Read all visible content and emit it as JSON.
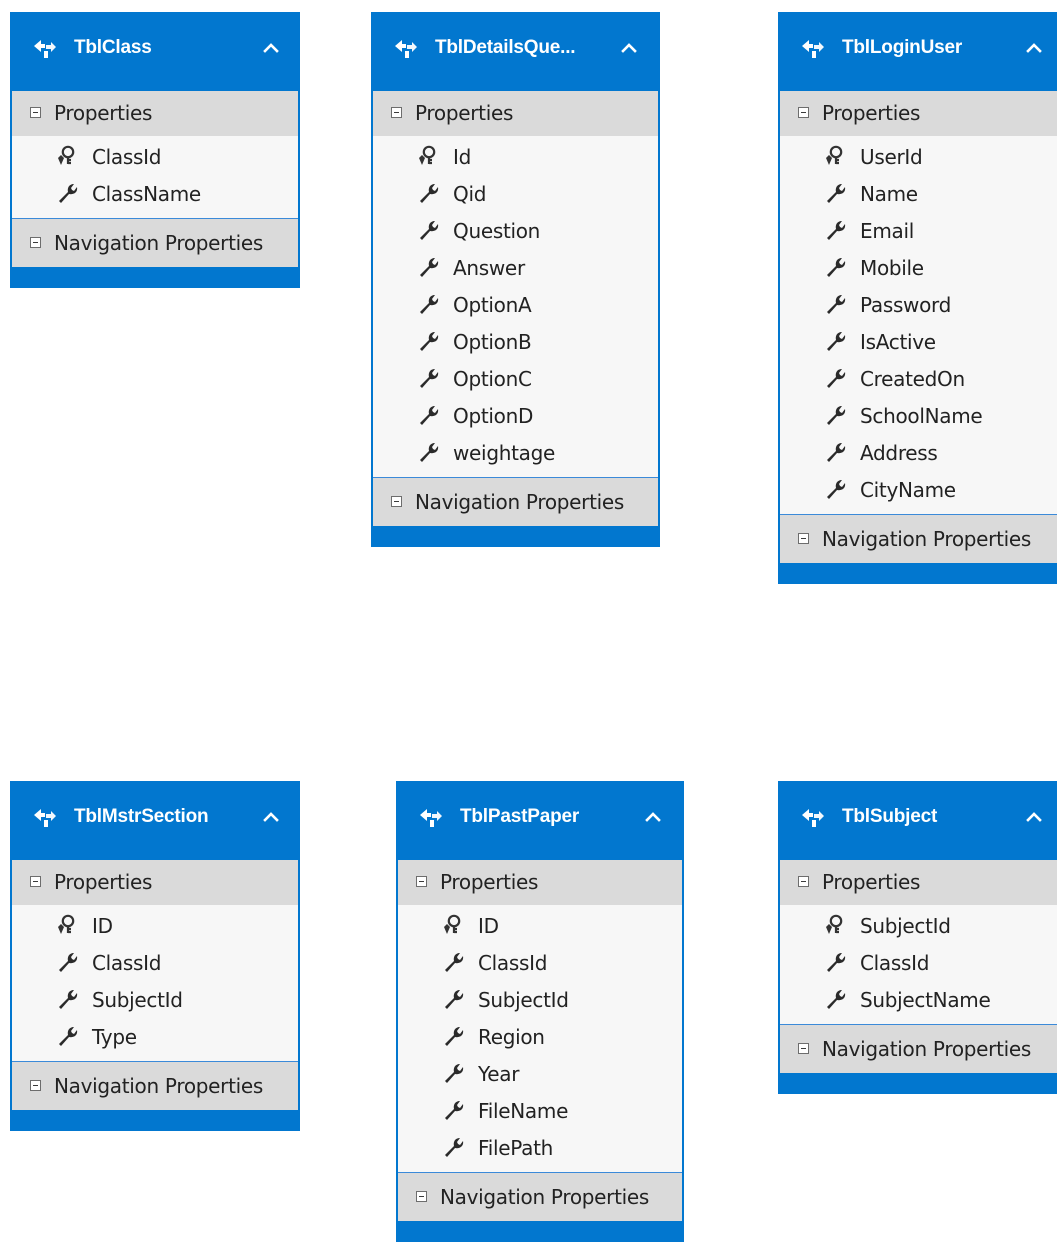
{
  "section_labels": {
    "properties": "Properties",
    "navigation": "Navigation Properties"
  },
  "entities": [
    {
      "title": "TblClass",
      "properties": [
        {
          "name": "ClassId",
          "key": true
        },
        {
          "name": "ClassName",
          "key": false
        }
      ]
    },
    {
      "title": "TblDetailsQue...",
      "properties": [
        {
          "name": "Id",
          "key": true
        },
        {
          "name": "Qid",
          "key": false
        },
        {
          "name": "Question",
          "key": false
        },
        {
          "name": "Answer",
          "key": false
        },
        {
          "name": "OptionA",
          "key": false
        },
        {
          "name": "OptionB",
          "key": false
        },
        {
          "name": "OptionC",
          "key": false
        },
        {
          "name": "OptionD",
          "key": false
        },
        {
          "name": "weightage",
          "key": false
        }
      ]
    },
    {
      "title": "TblLoginUser",
      "properties": [
        {
          "name": "UserId",
          "key": true
        },
        {
          "name": "Name",
          "key": false
        },
        {
          "name": "Email",
          "key": false
        },
        {
          "name": "Mobile",
          "key": false
        },
        {
          "name": "Password",
          "key": false
        },
        {
          "name": "IsActive",
          "key": false
        },
        {
          "name": "CreatedOn",
          "key": false
        },
        {
          "name": "SchoolName",
          "key": false
        },
        {
          "name": "Address",
          "key": false
        },
        {
          "name": "CityName",
          "key": false
        }
      ]
    },
    {
      "title": "TblMstrSection",
      "properties": [
        {
          "name": "ID",
          "key": true
        },
        {
          "name": "ClassId",
          "key": false
        },
        {
          "name": "SubjectId",
          "key": false
        },
        {
          "name": "Type",
          "key": false
        }
      ]
    },
    {
      "title": "TblPastPaper",
      "properties": [
        {
          "name": "ID",
          "key": true
        },
        {
          "name": "ClassId",
          "key": false
        },
        {
          "name": "SubjectId",
          "key": false
        },
        {
          "name": "Region",
          "key": false
        },
        {
          "name": "Year",
          "key": false
        },
        {
          "name": "FileName",
          "key": false
        },
        {
          "name": "FilePath",
          "key": false
        }
      ]
    },
    {
      "title": "TblSubject",
      "properties": [
        {
          "name": "SubjectId",
          "key": true
        },
        {
          "name": "ClassId",
          "key": false
        },
        {
          "name": "SubjectName",
          "key": false
        }
      ]
    }
  ],
  "colors": {
    "header_blue": "#0277cf",
    "section_gray": "#dadada",
    "body_bg": "#f7f7f7",
    "text": "#222222"
  },
  "icons": {
    "entity": "entity-type-icon",
    "collapse": "chevron-up-icon",
    "key_property": "key-property-icon",
    "scalar_property": "wrench-property-icon",
    "section_toggle": "collapse-toggle-icon"
  }
}
